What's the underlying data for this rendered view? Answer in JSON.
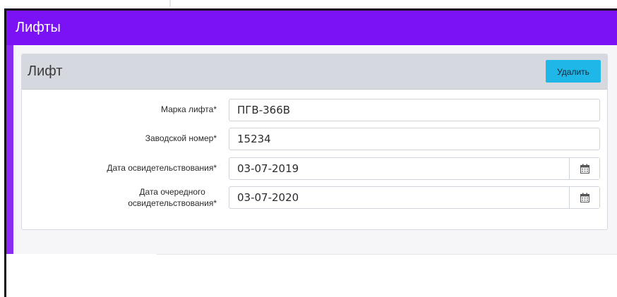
{
  "app": {
    "title": "Лифты"
  },
  "panel": {
    "title": "Лифт",
    "delete_label": "Удалить"
  },
  "form": {
    "fields": [
      {
        "label": "Марка лифта*",
        "value": "ПГВ-366В"
      },
      {
        "label": "Заводской номер*",
        "value": "15234"
      },
      {
        "label": "Дата освидетельствования*",
        "value": "03-07-2019",
        "icon": "calendar-icon"
      },
      {
        "label_line1": "Дата очередного",
        "label_line2": "освидетельствования*",
        "value": "03-07-2020",
        "icon": "calendar-icon"
      }
    ]
  },
  "colors": {
    "header": "#7a12f5",
    "delete_button": "#1fb6e8",
    "panel_header": "#d5d8de"
  }
}
